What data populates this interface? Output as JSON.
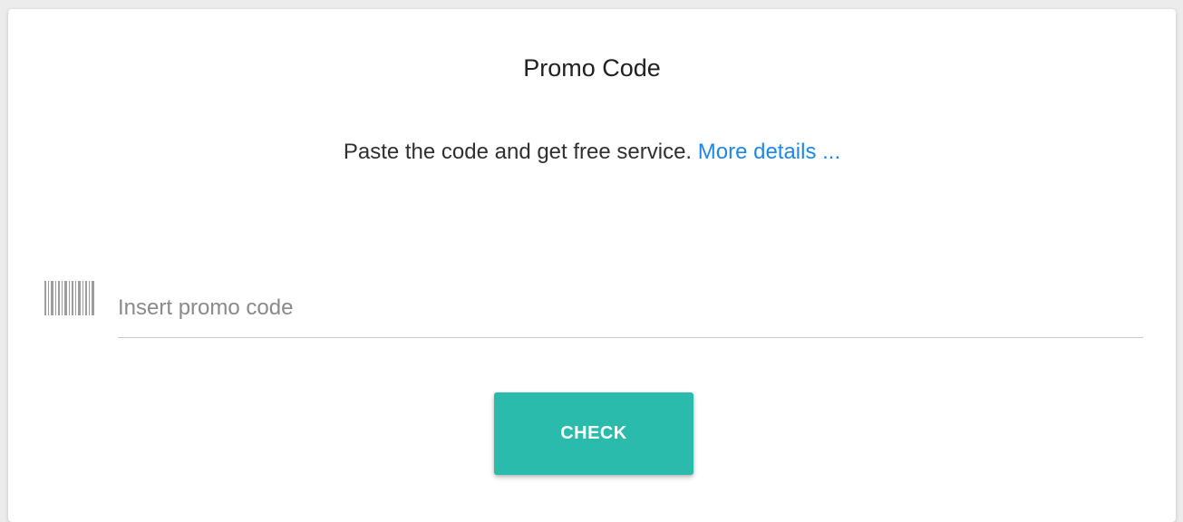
{
  "card": {
    "title": "Promo Code",
    "description": "Paste the code and get free service.",
    "details_link": "More details ..."
  },
  "promo_input": {
    "icon": "barcode-icon",
    "value": "",
    "placeholder": "Insert promo code"
  },
  "check_button": {
    "label": "CHECK",
    "color": "#2bbbad"
  },
  "colors": {
    "link": "#1e88e5",
    "underline": "#c9c9d6"
  }
}
